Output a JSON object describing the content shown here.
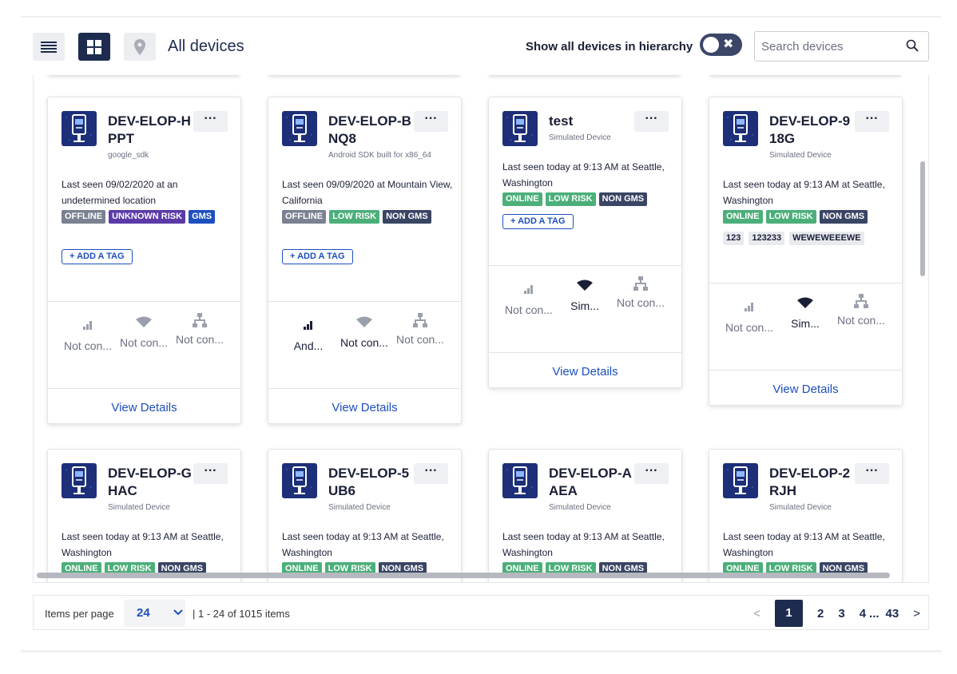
{
  "toolbar": {
    "title": "All devices",
    "hierarchy_label": "Show all devices in hierarchy",
    "search_placeholder": "Search devices"
  },
  "card_common": {
    "more_label": "···",
    "add_tag_label": "+ ADD A TAG",
    "view_details_label": "View Details"
  },
  "cards": [
    {
      "name": "DEV-ELOP-H PPT",
      "model": "google_sdk",
      "last_seen": "Last seen 09/02/2020 at an undetermined location",
      "tags": [
        "OFFLINE",
        "UNKNOWN RISK",
        "GMS"
      ],
      "stats": [
        "Not con...",
        "Not con...",
        "Not con..."
      ]
    },
    {
      "name": "DEV-ELOP-B NQ8",
      "model": "Android SDK built for x86_64",
      "last_seen": "Last seen 09/09/2020 at Mountain View, California",
      "tags": [
        "OFFLINE",
        "LOW RISK",
        "NON GMS"
      ],
      "stats": [
        "And...",
        "Not con...",
        "Not con..."
      ]
    },
    {
      "name": "test",
      "model": "Simulated Device",
      "last_seen": "Last seen today at 9:13 AM at Seattle, Washington",
      "tags": [
        "ONLINE",
        "LOW RISK",
        "NON GMS"
      ],
      "stats": [
        "Not con...",
        "Sim...",
        "Not con..."
      ]
    },
    {
      "name": "DEV-ELOP-9 18G",
      "model": "Simulated Device",
      "last_seen": "Last seen today at 9:13 AM at Seattle, Washington",
      "tags": [
        "ONLINE",
        "LOW RISK",
        "NON GMS"
      ],
      "custom_tags": [
        "123",
        "123233",
        "WEWEWEEEWE"
      ],
      "stats": [
        "Not con...",
        "Sim...",
        "Not con..."
      ]
    },
    {
      "name": "DEV-ELOP-G HAC",
      "model": "Simulated Device",
      "last_seen": "Last seen today at 9:13 AM at Seattle, Washington",
      "tags": [
        "ONLINE",
        "LOW RISK",
        "NON GMS"
      ]
    },
    {
      "name": "DEV-ELOP-5 UB6",
      "model": "Simulated Device",
      "last_seen": "Last seen today at 9:13 AM at Seattle, Washington",
      "tags": [
        "ONLINE",
        "LOW RISK",
        "NON GMS"
      ]
    },
    {
      "name": "DEV-ELOP-A AEA",
      "model": "Simulated Device",
      "last_seen": "Last seen today at 9:13 AM at Seattle, Washington",
      "tags": [
        "ONLINE",
        "LOW RISK",
        "NON GMS"
      ]
    },
    {
      "name": "DEV-ELOP-2 RJH",
      "model": "Simulated Device",
      "last_seen": "Last seen today at 9:13 AM at Seattle, Washington",
      "tags": [
        "ONLINE",
        "LOW RISK",
        "NON GMS"
      ]
    }
  ],
  "footer": {
    "items_per_page_label": "Items per page",
    "items_per_page_value": "24",
    "range_text": "| 1 - 24 of 1015 items",
    "pages": [
      "1",
      "2",
      "3",
      "4",
      "...",
      "43"
    ],
    "current_page": "1",
    "prev_label": "<",
    "next_label": ">"
  },
  "colors": {
    "primary_dark": "#1d2b4f",
    "link_blue": "#1d4fbf",
    "tag_green": "#4caf7a",
    "tag_purple": "#5b3aa8",
    "tag_gray": "#7a8191"
  }
}
